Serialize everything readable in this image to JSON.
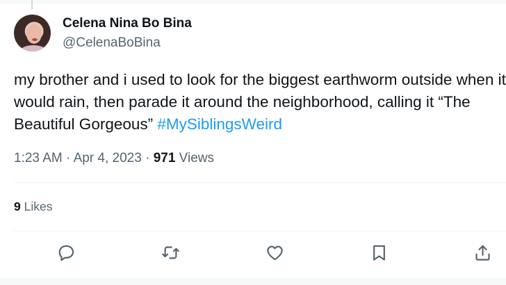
{
  "author": {
    "name": "Celena Nina Bo Bina",
    "handle": "@CelenaBoBina"
  },
  "tweet": {
    "line1": "my brother and i used to look for the biggest earthworm outside when it",
    "line2": "would rain, then parade it around the neighborhood, calling it “The",
    "line3_text": "Beautiful Gorgeous” ",
    "hashtag": "#MySiblingsWeird"
  },
  "meta": {
    "time": "1:23 AM",
    "sep1": " · ",
    "date": "Apr 4, 2023",
    "sep2": " · ",
    "views_count": "971",
    "views_label": " Views"
  },
  "likes": {
    "count": "9",
    "label": " Likes"
  },
  "actions": [
    "reply-icon",
    "retweet-icon",
    "like-icon",
    "bookmark-icon",
    "share-icon"
  ],
  "colors": {
    "text": "#0f1419",
    "secondary": "#536471",
    "link": "#1d9bf0",
    "divider": "#eff3f4"
  }
}
